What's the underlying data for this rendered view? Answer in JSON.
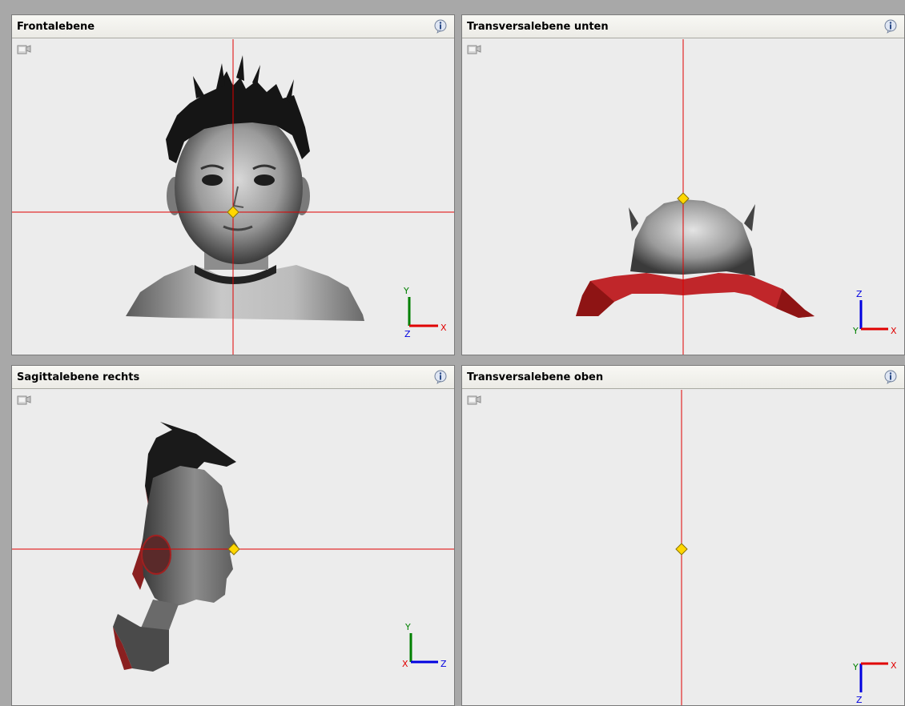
{
  "panels": {
    "top_left": {
      "title": "Frontalebene"
    },
    "top_right": {
      "title": "Transversalebene unten"
    },
    "bottom_left": {
      "title": "Sagittalebene rechts"
    },
    "bottom_right": {
      "title": "Transversalebene oben"
    }
  },
  "axes": {
    "frontal": {
      "up": "Y",
      "right": "X",
      "origin": "Z"
    },
    "transversal_unten": {
      "up": "Z",
      "right": "X",
      "origin": "Y"
    },
    "sagittal": {
      "up": "Y",
      "right": "Z",
      "origin": "X"
    },
    "transversal_oben": {
      "down": "Z",
      "right": "X",
      "origin": "Y"
    }
  },
  "colors": {
    "crosshair": "#e00000",
    "marker": "#ffd700",
    "axis_x": "#e00000",
    "axis_y": "#008000",
    "axis_z": "#0000e0"
  },
  "icons": {
    "info": "info-icon",
    "view_settings": "camera-view-icon"
  }
}
